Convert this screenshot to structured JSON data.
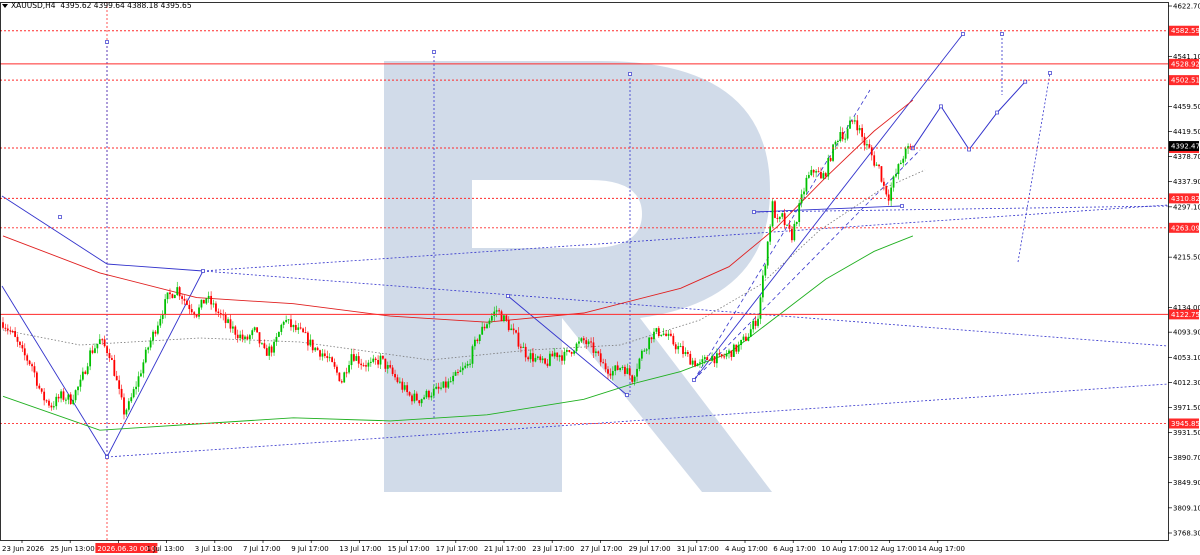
{
  "header": {
    "symbol": "XAUUSD,H4",
    "ohlc": "4395.62 4399.64 4388.18 4395.65"
  },
  "colors": {
    "bull": "#00c000",
    "bear": "#ff0000",
    "level_line": "#ff2a2a",
    "forecast_line": "#3333cc",
    "ma_red": "#e02020",
    "ma_green": "#20b020",
    "watermark": "#c5d2e4",
    "axis_text": "#000000"
  },
  "chart_data": {
    "type": "candlestick",
    "timeframe": "H4",
    "ylim": [
      3768.3,
      4622.7
    ],
    "price_ticks": [
      "4622.70",
      "4541.10",
      "4459.50",
      "4419.50",
      "4378.70",
      "4337.90",
      "4297.10",
      "4215.50",
      "4134.00",
      "4093.90",
      "4053.10",
      "4012.30",
      "3971.50",
      "3931.50",
      "3890.70",
      "3849.90",
      "3809.10",
      "3768.30"
    ],
    "time_labels": [
      "23 Jun 2026",
      "25 Jun 13:00",
      "2026.06.30 00:00",
      "1 Jul 13:00",
      "3 Jul 13:00",
      "7 Jul 17:00",
      "9 Jul 17:00",
      "13 Jul 17:00",
      "15 Jul 17:00",
      "17 Jul 17:00",
      "21 Jul 17:00",
      "23 Jul 17:00",
      "27 Jul 17:00",
      "29 Jul 17:00",
      "31 Jul 17:00",
      "4 Aug 17:00",
      "6 Aug 17:00",
      "10 Aug 17:00",
      "12 Aug 17:00",
      "14 Aug 17:00"
    ],
    "highlighted_time_label": "2026.06.30 00:00",
    "levels": [
      {
        "price": 4582.59,
        "label": "4582.59",
        "style": "dotted"
      },
      {
        "price": 4528.92,
        "label": "4528.92",
        "style": "solid"
      },
      {
        "price": 4502.51,
        "label": "4502.51",
        "style": "dotted"
      },
      {
        "price": 4392.47,
        "label": "4392.47",
        "style": "dotted"
      },
      {
        "price": 4310.82,
        "label": "4310.82",
        "style": "dotted"
      },
      {
        "price": 4263.09,
        "label": "4263.09",
        "style": "dotted"
      },
      {
        "price": 4122.75,
        "label": "4122.75",
        "style": "solid"
      },
      {
        "price": 3945.85,
        "label": "3945.85",
        "style": "dotted"
      }
    ],
    "current_price": {
      "price": 4395.65,
      "label": "4392.47"
    },
    "close_path": [
      [
        0,
        4110
      ],
      [
        4,
        4090
      ],
      [
        8,
        4060
      ],
      [
        12,
        4040
      ],
      [
        16,
        3990
      ],
      [
        20,
        3975
      ],
      [
        24,
        3990
      ],
      [
        28,
        3985
      ],
      [
        32,
        4010
      ],
      [
        36,
        4060
      ],
      [
        40,
        4080
      ],
      [
        44,
        4060
      ],
      [
        46,
        4030
      ],
      [
        48,
        3995
      ],
      [
        50,
        3965
      ],
      [
        52,
        3975
      ],
      [
        56,
        4020
      ],
      [
        60,
        4070
      ],
      [
        64,
        4110
      ],
      [
        68,
        4150
      ],
      [
        72,
        4165
      ],
      [
        76,
        4140
      ],
      [
        80,
        4125
      ],
      [
        84,
        4150
      ],
      [
        88,
        4130
      ],
      [
        92,
        4110
      ],
      [
        96,
        4095
      ],
      [
        100,
        4080
      ],
      [
        104,
        4095
      ],
      [
        108,
        4060
      ],
      [
        112,
        4070
      ],
      [
        116,
        4115
      ],
      [
        120,
        4100
      ],
      [
        124,
        4090
      ],
      [
        128,
        4070
      ],
      [
        132,
        4060
      ],
      [
        136,
        4040
      ],
      [
        140,
        4015
      ],
      [
        144,
        4060
      ],
      [
        148,
        4045
      ],
      [
        152,
        4040
      ],
      [
        156,
        4050
      ],
      [
        160,
        4030
      ],
      [
        164,
        4010
      ],
      [
        168,
        3990
      ],
      [
        172,
        3985
      ],
      [
        176,
        3995
      ],
      [
        180,
        4000
      ],
      [
        184,
        4010
      ],
      [
        188,
        4025
      ],
      [
        192,
        4040
      ],
      [
        196,
        4085
      ],
      [
        200,
        4110
      ],
      [
        204,
        4130
      ],
      [
        208,
        4110
      ],
      [
        212,
        4085
      ],
      [
        216,
        4060
      ],
      [
        220,
        4050
      ],
      [
        224,
        4040
      ],
      [
        228,
        4060
      ],
      [
        232,
        4055
      ],
      [
        236,
        4070
      ],
      [
        240,
        4080
      ],
      [
        244,
        4065
      ],
      [
        248,
        4040
      ],
      [
        252,
        4030
      ],
      [
        256,
        4040
      ],
      [
        260,
        4020
      ],
      [
        264,
        4060
      ],
      [
        268,
        4090
      ],
      [
        272,
        4095
      ],
      [
        276,
        4080
      ],
      [
        280,
        4065
      ],
      [
        284,
        4050
      ],
      [
        288,
        4040
      ],
      [
        292,
        4055
      ],
      [
        296,
        4050
      ],
      [
        300,
        4060
      ],
      [
        304,
        4070
      ],
      [
        308,
        4090
      ],
      [
        312,
        4120
      ],
      [
        314,
        4180
      ],
      [
        316,
        4240
      ],
      [
        318,
        4300
      ],
      [
        320,
        4270
      ],
      [
        322,
        4280
      ],
      [
        324,
        4260
      ],
      [
        326,
        4250
      ],
      [
        328,
        4280
      ],
      [
        330,
        4310
      ],
      [
        332,
        4340
      ],
      [
        334,
        4350
      ],
      [
        336,
        4360
      ],
      [
        338,
        4340
      ],
      [
        340,
        4355
      ],
      [
        342,
        4380
      ],
      [
        344,
        4400
      ],
      [
        346,
        4420
      ],
      [
        348,
        4410
      ],
      [
        350,
        4430
      ],
      [
        352,
        4440
      ],
      [
        354,
        4420
      ],
      [
        356,
        4400
      ],
      [
        358,
        4390
      ],
      [
        360,
        4370
      ],
      [
        362,
        4360
      ],
      [
        364,
        4330
      ],
      [
        366,
        4315
      ],
      [
        368,
        4340
      ],
      [
        370,
        4360
      ],
      [
        372,
        4380
      ],
      [
        374,
        4390
      ],
      [
        376,
        4392
      ]
    ],
    "forecast_path": [
      [
        376,
        4392
      ],
      [
        380,
        4460
      ],
      [
        384,
        4390
      ],
      [
        388,
        4450
      ],
      [
        392,
        4500
      ]
    ],
    "series": [
      {
        "name": "",
        "color": "red",
        "points": [
          [
            0,
            4250
          ],
          [
            40,
            4190
          ],
          [
            80,
            4150
          ],
          [
            120,
            4140
          ],
          [
            160,
            4120
          ],
          [
            200,
            4110
          ],
          [
            240,
            4125
          ],
          [
            280,
            4165
          ],
          [
            300,
            4200
          ],
          [
            320,
            4265
          ],
          [
            340,
            4345
          ],
          [
            360,
            4420
          ],
          [
            376,
            4470
          ]
        ]
      },
      {
        "name": "",
        "color": "green",
        "points": [
          [
            0,
            3990
          ],
          [
            40,
            3935
          ],
          [
            80,
            3945
          ],
          [
            120,
            3955
          ],
          [
            160,
            3950
          ],
          [
            200,
            3960
          ],
          [
            240,
            3985
          ],
          [
            260,
            4010
          ],
          [
            280,
            4030
          ],
          [
            300,
            4060
          ],
          [
            320,
            4120
          ],
          [
            340,
            4180
          ],
          [
            360,
            4225
          ],
          [
            376,
            4250
          ]
        ]
      }
    ]
  }
}
